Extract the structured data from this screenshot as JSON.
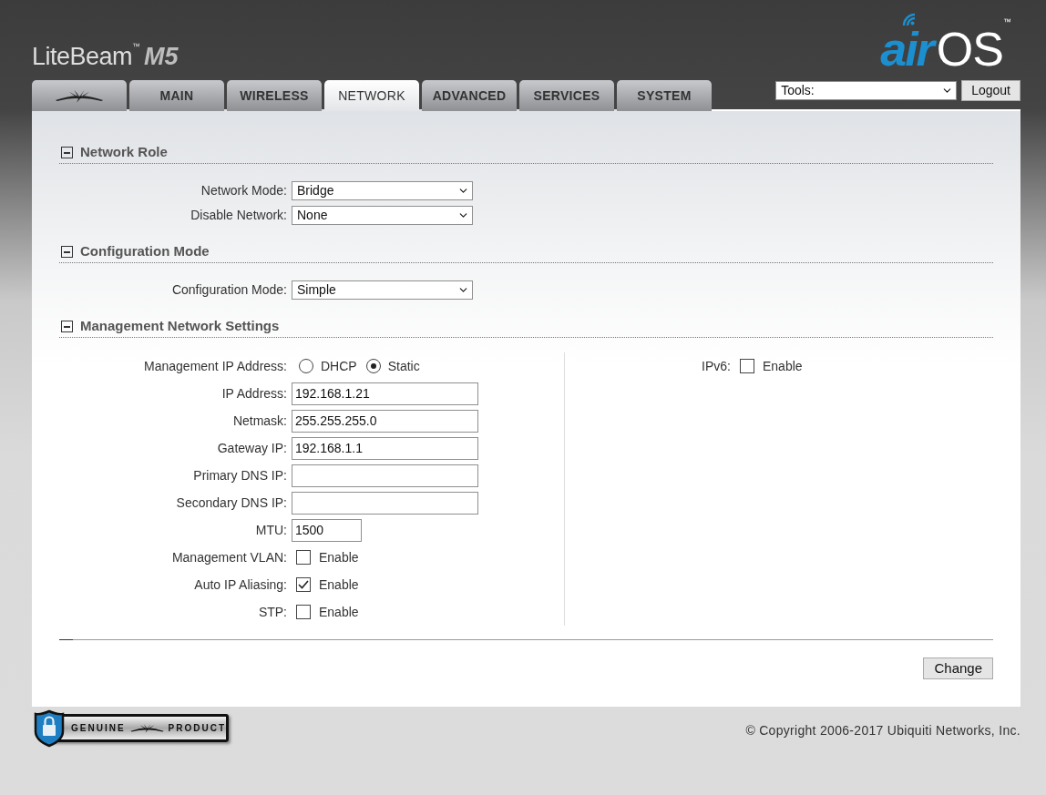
{
  "header": {
    "product": "LiteBeam",
    "trademark": "™",
    "model": "M5"
  },
  "brand": {
    "prefix": "air",
    "name": "OS",
    "trademark": "™"
  },
  "tabs": [
    {
      "kind": "logo",
      "selected": false
    },
    {
      "kind": "text",
      "label": "MAIN",
      "selected": false
    },
    {
      "kind": "text",
      "label": "WIRELESS",
      "selected": false
    },
    {
      "kind": "text",
      "label": "NETWORK",
      "selected": true
    },
    {
      "kind": "text",
      "label": "ADVANCED",
      "selected": false
    },
    {
      "kind": "text",
      "label": "SERVICES",
      "selected": false
    },
    {
      "kind": "text",
      "label": "SYSTEM",
      "selected": false
    }
  ],
  "tools": {
    "value": "Tools:"
  },
  "logout": "Logout",
  "sections": [
    {
      "title": "Network Role",
      "expanded": true,
      "columns": [
        {
          "rows": [
            {
              "kind": "select",
              "label": "Network Mode:",
              "value": "Bridge"
            },
            {
              "kind": "select",
              "label": "Disable Network:",
              "value": "None"
            }
          ]
        }
      ]
    },
    {
      "title": "Configuration Mode",
      "expanded": true,
      "columns": [
        {
          "rows": [
            {
              "kind": "select",
              "label": "Configuration Mode:",
              "value": "Simple"
            }
          ]
        }
      ]
    },
    {
      "title": "Management Network Settings",
      "expanded": true,
      "columns": [
        {
          "rows": [
            {
              "kind": "radio",
              "label": "Management IP Address:",
              "options": [
                {
                  "label": "DHCP",
                  "selected": false
                },
                {
                  "label": "Static",
                  "selected": true
                }
              ]
            },
            {
              "kind": "input",
              "label": "IP Address:",
              "value": "192.168.1.21"
            },
            {
              "kind": "input",
              "label": "Netmask:",
              "value": "255.255.255.0"
            },
            {
              "kind": "input",
              "label": "Gateway IP:",
              "value": "192.168.1.1"
            },
            {
              "kind": "input",
              "label": "Primary DNS IP:"
            },
            {
              "kind": "input",
              "label": "Secondary DNS IP:"
            },
            {
              "kind": "shortinput",
              "label": "MTU:",
              "value": "1500"
            },
            {
              "kind": "checkbox",
              "label": "Management VLAN:",
              "text": "Enable",
              "checked": false
            },
            {
              "kind": "checkbox",
              "label": "Auto IP Aliasing:",
              "text": "Enable",
              "checked": true
            },
            {
              "kind": "checkbox",
              "label": "STP:",
              "text": "Enable",
              "checked": false
            }
          ]
        },
        {
          "rows": [
            {
              "kind": "checkbox",
              "label": "IPv6:",
              "text": "Enable",
              "checked": false
            }
          ]
        }
      ]
    }
  ],
  "change": "Change",
  "badge": {
    "left": "GENUINE",
    "right": "PRODUCT"
  },
  "copyright": "© Copyright 2006-2017 Ubiquiti Networks, Inc."
}
